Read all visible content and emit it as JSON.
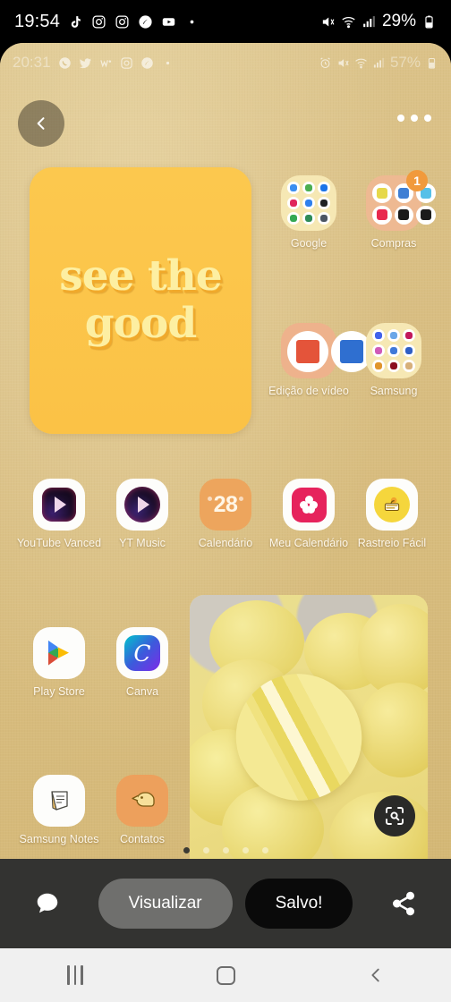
{
  "system_status_bar": {
    "clock": "19:54",
    "battery_percent": "29%",
    "notification_icons": [
      "tiktok-icon",
      "instagram-icon",
      "instagram-icon",
      "shazam-icon",
      "youtube-icon",
      "more-dot-icon"
    ],
    "status_icons": [
      "mute-icon",
      "wifi-icon",
      "signal-icon",
      "battery-icon"
    ]
  },
  "screenshot_preview": {
    "inner_status_bar": {
      "clock": "20:31",
      "battery_percent": "57%",
      "notification_icons": [
        "whatsapp-icon",
        "twitter-icon",
        "w-icon",
        "instagram-icon",
        "shazam-icon",
        "more-dot-icon"
      ],
      "status_icons": [
        "alarm-icon",
        "mute-icon",
        "wifi-icon",
        "signal-icon",
        "battery-icon"
      ]
    },
    "back_button_icon": "chevron-left-icon",
    "overflow_menu_icon": "more-horizontal-icon",
    "quote_widget": {
      "line1": "see the",
      "line2": "good",
      "background_color": "#fbc246",
      "text_color": "#fdefa2"
    },
    "folders": [
      {
        "label": "Google",
        "icon_count": 9,
        "background_color": "#f6e8b4",
        "badge": null,
        "icon_colors": [
          "#3b8ef0",
          "#4cae50",
          "#1a73e8",
          "#e0265c",
          "#2f80ed",
          "#202124",
          "#34a853",
          "#2e8b57",
          "#4b5563"
        ]
      },
      {
        "label": "Compras",
        "icon_count": 6,
        "background_color": "#eeb992",
        "badge": "1",
        "badge_color": "#f19a3c",
        "icon_colors": [
          "#e6d84a",
          "#3f7fd4",
          "#55c0e8",
          "#e8284e",
          "#1b1b1b",
          "#1b1b1b"
        ]
      },
      {
        "label": "Edição de vídeo",
        "icon_count": 3,
        "background_color": "#eeb28c",
        "badge": null,
        "icon_colors": [
          "#e4543a",
          "#2f6fd0",
          "#2b2b2b"
        ]
      },
      {
        "label": "Samsung",
        "icon_count": 9,
        "background_color": "#f6e8b4",
        "badge": null,
        "icon_colors": [
          "#4263eb",
          "#6aa7e8",
          "#c2185b",
          "#d05ab8",
          "#3f78d8",
          "#2f5fc4",
          "#e0952c",
          "#8b0d1e",
          "#d7b07a"
        ]
      }
    ],
    "apps": [
      {
        "label": "YouTube Vanced",
        "icon": "youtube-vanced-icon"
      },
      {
        "label": "YT Music",
        "icon": "yt-music-icon"
      },
      {
        "label": "Calendário",
        "icon": "calendar-icon",
        "day_number": "28"
      },
      {
        "label": "Meu Calendário",
        "icon": "meu-calendario-icon"
      },
      {
        "label": "Rastreio Fácil",
        "icon": "rastreio-facil-icon"
      },
      {
        "label": "Play Store",
        "icon": "play-store-icon"
      },
      {
        "label": "Canva",
        "icon": "canva-icon",
        "glyph": "C"
      },
      {
        "label": "Samsung Notes",
        "icon": "samsung-notes-icon"
      },
      {
        "label": "Contatos",
        "icon": "contatos-icon"
      }
    ],
    "photo_widget": {
      "subject": "yellow macarons",
      "lens_button_icon": "google-lens-icon"
    },
    "page_indicator": {
      "total": 5,
      "active_index": 0
    }
  },
  "action_bar": {
    "comment_icon": "comment-bubble-icon",
    "preview_label": "Visualizar",
    "saved_label": "Salvo!",
    "share_icon": "share-icon"
  },
  "navigation_bar": {
    "recents_icon": "recents-icon",
    "home_icon": "home-icon",
    "back_icon": "back-icon"
  }
}
